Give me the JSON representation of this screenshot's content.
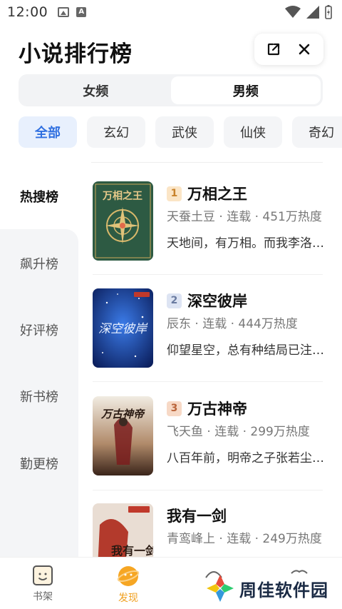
{
  "status_bar": {
    "time": "12:00"
  },
  "header": {
    "title": "小说排行榜"
  },
  "gender_tabs": [
    {
      "label": "女频",
      "active": false
    },
    {
      "label": "男频",
      "active": true
    }
  ],
  "genres": [
    {
      "label": "全部",
      "active": true
    },
    {
      "label": "玄幻",
      "active": false
    },
    {
      "label": "武侠",
      "active": false
    },
    {
      "label": "仙侠",
      "active": false
    },
    {
      "label": "奇幻",
      "active": false
    }
  ],
  "rank_menu": [
    {
      "label": "热搜榜",
      "active": true
    },
    {
      "label": "飙升榜",
      "active": false
    },
    {
      "label": "好评榜",
      "active": false
    },
    {
      "label": "新书榜",
      "active": false
    },
    {
      "label": "勤更榜",
      "active": false
    }
  ],
  "books": [
    {
      "rank": "1",
      "title": "万相之王",
      "meta": "天蚕土豆 · 连载 · 451万热度",
      "desc": "天地间，有万相。而我李洛，终将成为这万相之王……",
      "cover_text": "万相之王"
    },
    {
      "rank": "2",
      "title": "深空彼岸",
      "meta": "辰东 · 连载 · 444万热度",
      "desc": "仰望星空，总有种结局已注定的孤独感……",
      "cover_text": "深空彼岸"
    },
    {
      "rank": "3",
      "title": "万古神帝",
      "meta": "飞天鱼 · 连载 · 299万热度",
      "desc": "八百年前，明帝之子张若尘，被他的未婚妻……",
      "cover_text": "万古神帝"
    },
    {
      "rank": "",
      "title": "我有一剑",
      "meta": "青鸾峰上 · 连载 · 249万热度",
      "desc": "",
      "cover_text": "我有一剑"
    }
  ],
  "bottom_nav": [
    {
      "label": "书架",
      "icon": "bookshelf-icon",
      "active": false
    },
    {
      "label": "发现",
      "icon": "discover-icon",
      "active": true
    },
    {
      "label": "",
      "icon": "partial-icon",
      "active": false
    },
    {
      "label": "",
      "icon": "partial-icon",
      "active": false
    }
  ],
  "watermark": {
    "text": "周佳软件园"
  },
  "colors": {
    "accent_blue": "#2f6fe0",
    "active_nav": "#f0a020",
    "chip_active_bg": "#e8f0fd"
  }
}
